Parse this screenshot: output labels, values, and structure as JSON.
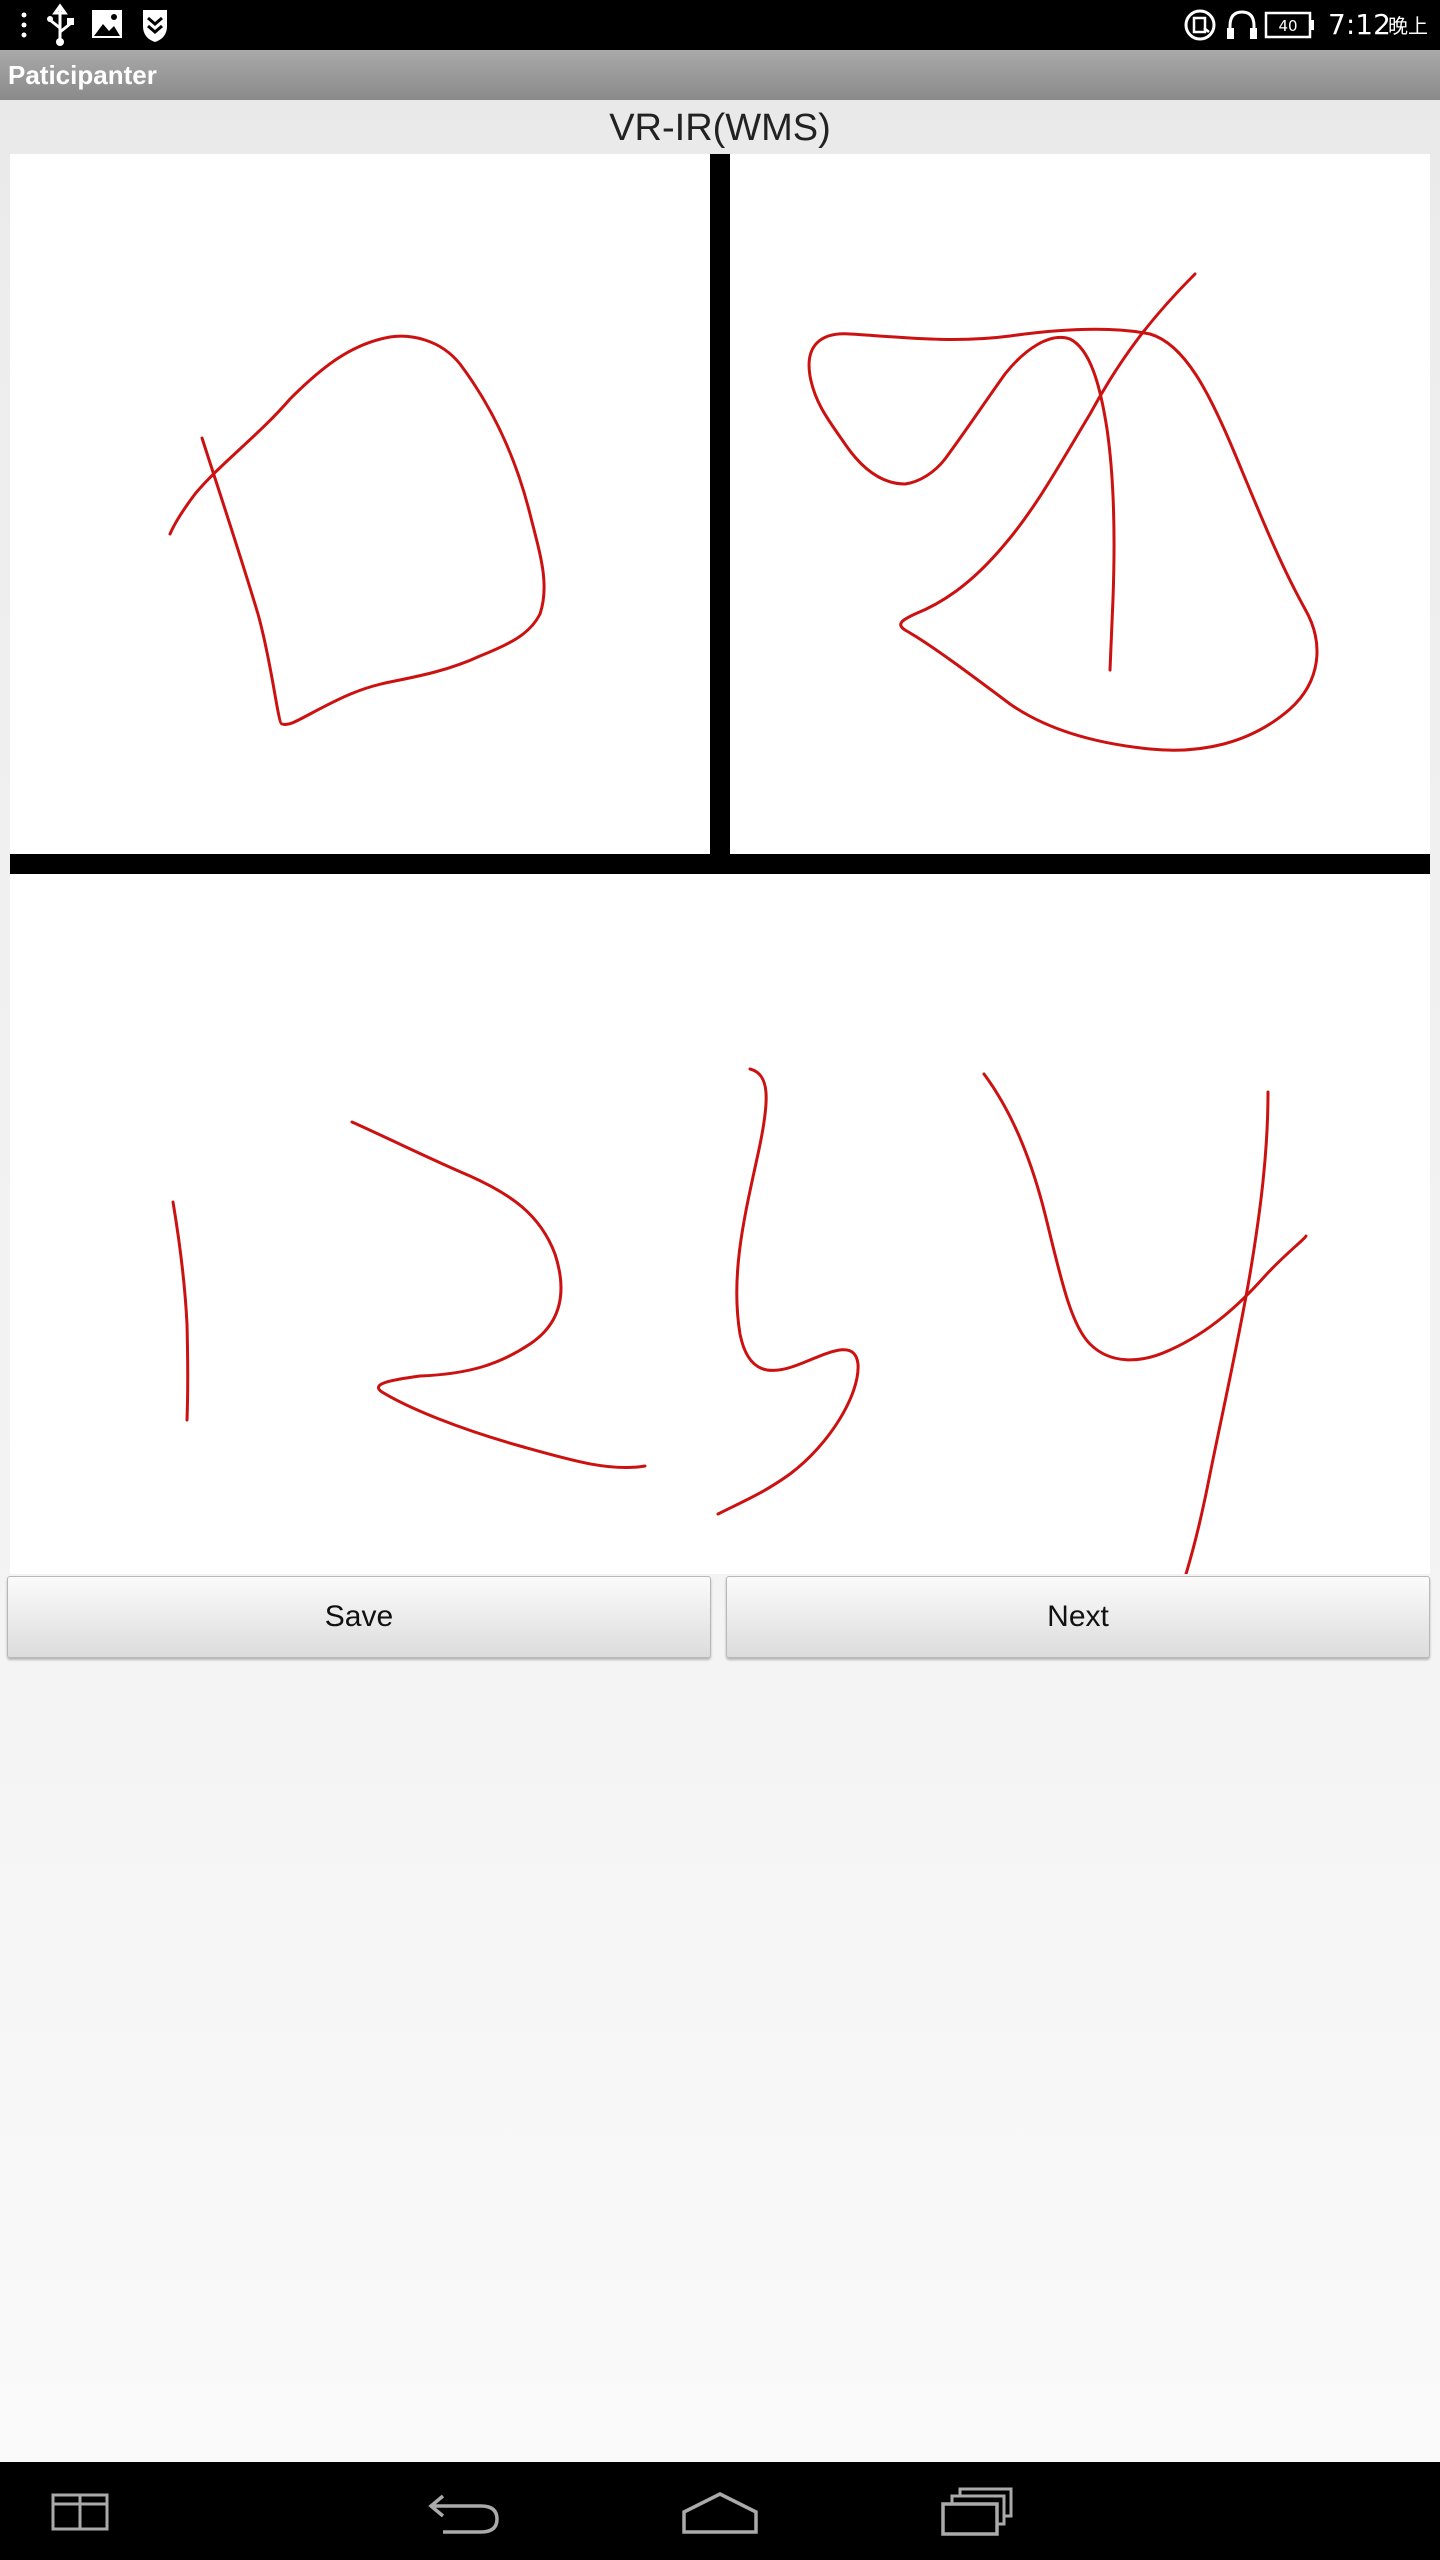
{
  "status_bar": {
    "time": "7:12",
    "ampm": "晚上",
    "battery_level": "40",
    "left_icons": [
      "menu-dots-icon",
      "usb-icon",
      "image-icon",
      "shield-icon"
    ],
    "right_icons": [
      "sync-icon",
      "headset-icon",
      "battery-icon"
    ]
  },
  "action_bar": {
    "title": "Paticipanter"
  },
  "page": {
    "heading": "VR-IR(WMS)"
  },
  "buttons": {
    "save": "Save",
    "next": "Next"
  },
  "nav_bar": {
    "icons": [
      "recent-split-icon",
      "back-icon",
      "home-icon",
      "recent-apps-icon"
    ]
  },
  "colors": {
    "ink": "#cc1111",
    "divider": "#000000",
    "status_bar": "#000000",
    "action_bar": "#999999"
  }
}
